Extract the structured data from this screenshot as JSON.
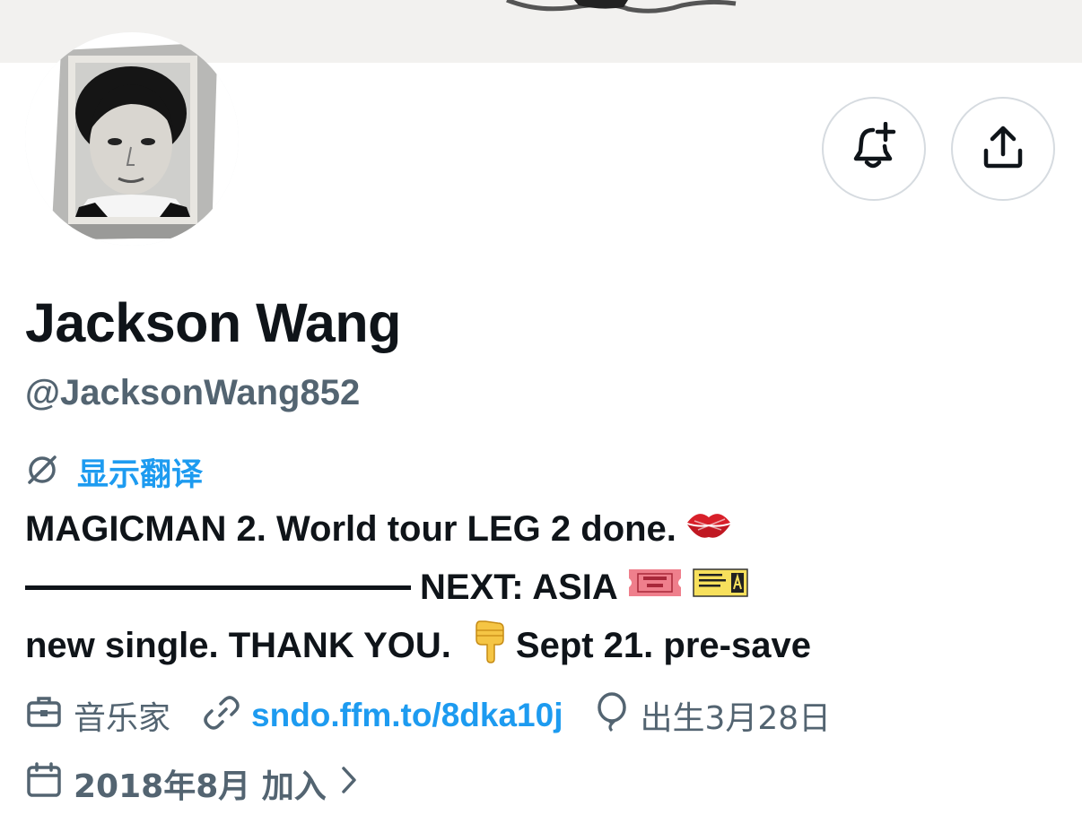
{
  "profile": {
    "name": "Jackson Wang",
    "handle": "@JacksonWang852",
    "translate_label": "显示翻译",
    "bio": {
      "line1": "MAGICMAN 2. World tour LEG 2 done.",
      "line2": "NEXT: ASIA",
      "line3_a": "new single. THANK YOU.",
      "line3_b": "Sept 21. pre-save"
    },
    "meta": {
      "profession": "音乐家",
      "link": "sndo.ffm.to/8dka10j",
      "birthday": "出生3月28日",
      "joined": "2018年8月 加入"
    }
  },
  "actions": {
    "notify": "bell-plus-icon",
    "share": "share-icon"
  },
  "icons": {
    "translate": "translate-icon",
    "profession": "briefcase-icon",
    "link": "link-icon",
    "birthday": "balloon-icon",
    "joined": "calendar-icon",
    "more": "chevron-right-icon",
    "emoji_lips": "kiss-mark-emoji",
    "emoji_ticket": "admission-ticket-emoji",
    "emoji_concert": "concert-ticket-emoji",
    "emoji_point": "pointing-down-emoji"
  },
  "colors": {
    "accent": "#1d9bf0",
    "text": "#0f1419",
    "muted": "#536471",
    "border": "#d6dbe0"
  }
}
